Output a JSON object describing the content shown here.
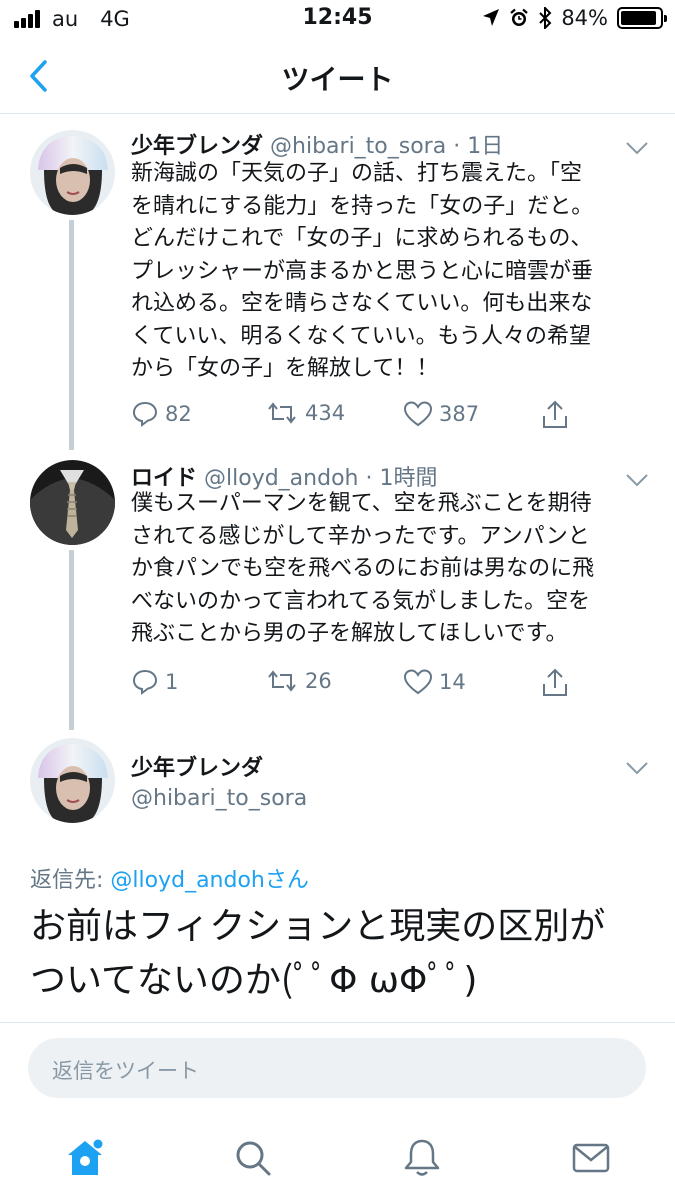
{
  "status_bar": {
    "carrier": "au",
    "network": "4G",
    "time": "12:45",
    "battery_percent": "84%",
    "battery_level": 0.84,
    "icons": [
      "location-icon",
      "alarm-icon",
      "bluetooth-icon"
    ]
  },
  "nav": {
    "title": "ツイート",
    "back_icon": "chevron-left-icon"
  },
  "colors": {
    "accent": "#1da1f2",
    "muted": "#657786",
    "text": "#14171a",
    "thread_line": "#c4cfd6"
  },
  "tweets": [
    {
      "name": "少年ブレンダ",
      "handle": "@hibari_to_sora",
      "time": "· 1日",
      "lines": [
        "新海誠の「天気の子」の話、打ち震えた。「空",
        "を晴れにする能力」を持った「女の子」だと。",
        "どんだけこれで「女の子」に求められるもの、",
        "プレッシャーが高まるかと思うと心に暗雲が垂",
        "れ込める。空を晴らさなくていい。何も出来な",
        "くていい、明るくなくていい。もう人々の希望",
        "から「女の子」を解放して！！"
      ],
      "replies": "82",
      "retweets": "434",
      "likes": "387"
    },
    {
      "name": "ロイド",
      "handle": "@lloyd_andoh",
      "time": "· 1時間",
      "lines": [
        "僕もスーパーマンを観て、空を飛ぶことを期待",
        "されてる感じがして辛かったです。アンパンと",
        "か食パンでも空を飛べるのにお前は男なのに飛",
        "べないのかって言われてる気がしました。空を",
        "飛ぶことから男の子を解放してほしいです。"
      ],
      "replies": "1",
      "retweets": "26",
      "likes": "14"
    },
    {
      "name": "少年ブレンダ",
      "handle": "@hibari_to_sora"
    }
  ],
  "reply_to": {
    "prefix": "返信先: ",
    "handle": "@lloyd_andoh",
    "suffix": "さん"
  },
  "main_tweet": {
    "lines": [
      "お前はフィクションと現実の区別が",
      "ついてないのか(ﾟﾟΦ ωΦﾟﾟ)"
    ]
  },
  "reply_box": {
    "placeholder": "返信をツイート"
  },
  "tab_bar": {
    "tabs": [
      "home-icon",
      "search-icon",
      "notifications-icon",
      "messages-icon"
    ],
    "active": "home-icon"
  }
}
